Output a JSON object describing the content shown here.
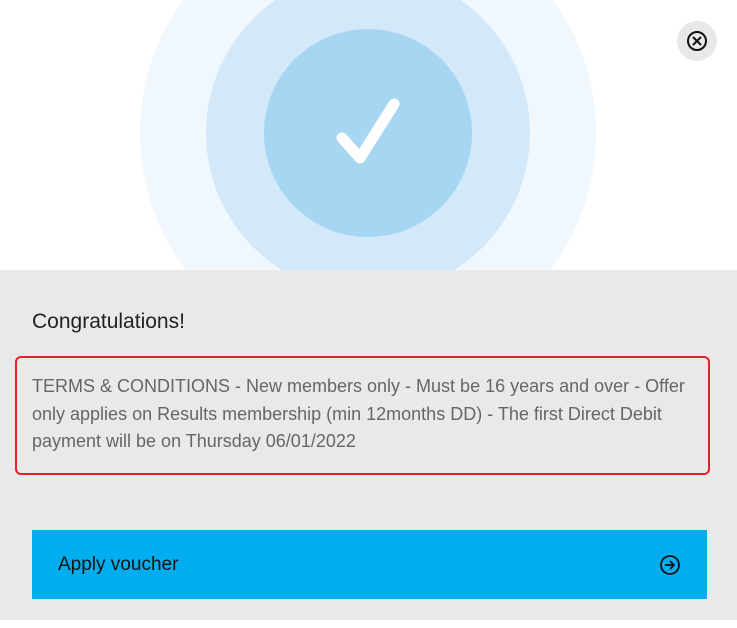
{
  "hero": {
    "icon": "checkmark-icon",
    "colors": {
      "outer": "#f0f7fd",
      "middle": "#d3e9f9",
      "inner": "#a7d6f3",
      "check": "#ffffff"
    }
  },
  "close_button": {
    "icon": "close-icon"
  },
  "dialog": {
    "title": "Congratulations!",
    "terms_text": "TERMS & CONDITIONS - New members only - Must be 16 years and over - Offer only applies on Results membership (min 12months DD) - The first Direct Debit payment will be on Thursday 06/01/2022",
    "apply_button_label": "Apply voucher",
    "apply_button_icon": "arrow-right-circle-icon",
    "accent_color": "#00aeef",
    "highlight_color": "#e8202a"
  }
}
